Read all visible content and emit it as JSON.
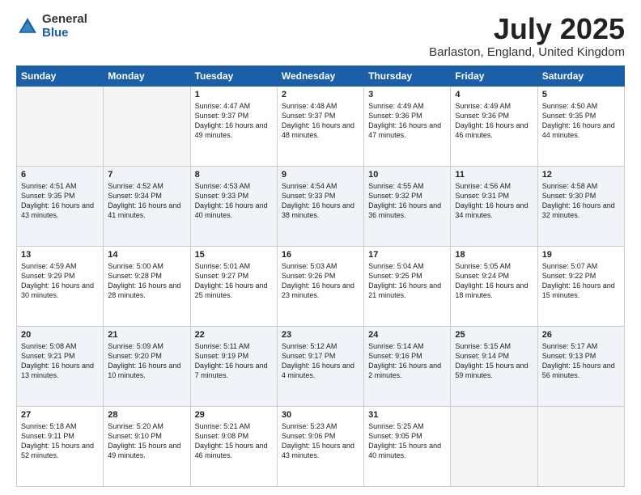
{
  "logo": {
    "general": "General",
    "blue": "Blue"
  },
  "title": {
    "month": "July 2025",
    "location": "Barlaston, England, United Kingdom"
  },
  "days_of_week": [
    "Sunday",
    "Monday",
    "Tuesday",
    "Wednesday",
    "Thursday",
    "Friday",
    "Saturday"
  ],
  "weeks": [
    [
      {
        "day": "",
        "sunrise": "",
        "sunset": "",
        "daylight": ""
      },
      {
        "day": "",
        "sunrise": "",
        "sunset": "",
        "daylight": ""
      },
      {
        "day": "1",
        "sunrise": "Sunrise: 4:47 AM",
        "sunset": "Sunset: 9:37 PM",
        "daylight": "Daylight: 16 hours and 49 minutes."
      },
      {
        "day": "2",
        "sunrise": "Sunrise: 4:48 AM",
        "sunset": "Sunset: 9:37 PM",
        "daylight": "Daylight: 16 hours and 48 minutes."
      },
      {
        "day": "3",
        "sunrise": "Sunrise: 4:49 AM",
        "sunset": "Sunset: 9:36 PM",
        "daylight": "Daylight: 16 hours and 47 minutes."
      },
      {
        "day": "4",
        "sunrise": "Sunrise: 4:49 AM",
        "sunset": "Sunset: 9:36 PM",
        "daylight": "Daylight: 16 hours and 46 minutes."
      },
      {
        "day": "5",
        "sunrise": "Sunrise: 4:50 AM",
        "sunset": "Sunset: 9:35 PM",
        "daylight": "Daylight: 16 hours and 44 minutes."
      }
    ],
    [
      {
        "day": "6",
        "sunrise": "Sunrise: 4:51 AM",
        "sunset": "Sunset: 9:35 PM",
        "daylight": "Daylight: 16 hours and 43 minutes."
      },
      {
        "day": "7",
        "sunrise": "Sunrise: 4:52 AM",
        "sunset": "Sunset: 9:34 PM",
        "daylight": "Daylight: 16 hours and 41 minutes."
      },
      {
        "day": "8",
        "sunrise": "Sunrise: 4:53 AM",
        "sunset": "Sunset: 9:33 PM",
        "daylight": "Daylight: 16 hours and 40 minutes."
      },
      {
        "day": "9",
        "sunrise": "Sunrise: 4:54 AM",
        "sunset": "Sunset: 9:33 PM",
        "daylight": "Daylight: 16 hours and 38 minutes."
      },
      {
        "day": "10",
        "sunrise": "Sunrise: 4:55 AM",
        "sunset": "Sunset: 9:32 PM",
        "daylight": "Daylight: 16 hours and 36 minutes."
      },
      {
        "day": "11",
        "sunrise": "Sunrise: 4:56 AM",
        "sunset": "Sunset: 9:31 PM",
        "daylight": "Daylight: 16 hours and 34 minutes."
      },
      {
        "day": "12",
        "sunrise": "Sunrise: 4:58 AM",
        "sunset": "Sunset: 9:30 PM",
        "daylight": "Daylight: 16 hours and 32 minutes."
      }
    ],
    [
      {
        "day": "13",
        "sunrise": "Sunrise: 4:59 AM",
        "sunset": "Sunset: 9:29 PM",
        "daylight": "Daylight: 16 hours and 30 minutes."
      },
      {
        "day": "14",
        "sunrise": "Sunrise: 5:00 AM",
        "sunset": "Sunset: 9:28 PM",
        "daylight": "Daylight: 16 hours and 28 minutes."
      },
      {
        "day": "15",
        "sunrise": "Sunrise: 5:01 AM",
        "sunset": "Sunset: 9:27 PM",
        "daylight": "Daylight: 16 hours and 25 minutes."
      },
      {
        "day": "16",
        "sunrise": "Sunrise: 5:03 AM",
        "sunset": "Sunset: 9:26 PM",
        "daylight": "Daylight: 16 hours and 23 minutes."
      },
      {
        "day": "17",
        "sunrise": "Sunrise: 5:04 AM",
        "sunset": "Sunset: 9:25 PM",
        "daylight": "Daylight: 16 hours and 21 minutes."
      },
      {
        "day": "18",
        "sunrise": "Sunrise: 5:05 AM",
        "sunset": "Sunset: 9:24 PM",
        "daylight": "Daylight: 16 hours and 18 minutes."
      },
      {
        "day": "19",
        "sunrise": "Sunrise: 5:07 AM",
        "sunset": "Sunset: 9:22 PM",
        "daylight": "Daylight: 16 hours and 15 minutes."
      }
    ],
    [
      {
        "day": "20",
        "sunrise": "Sunrise: 5:08 AM",
        "sunset": "Sunset: 9:21 PM",
        "daylight": "Daylight: 16 hours and 13 minutes."
      },
      {
        "day": "21",
        "sunrise": "Sunrise: 5:09 AM",
        "sunset": "Sunset: 9:20 PM",
        "daylight": "Daylight: 16 hours and 10 minutes."
      },
      {
        "day": "22",
        "sunrise": "Sunrise: 5:11 AM",
        "sunset": "Sunset: 9:19 PM",
        "daylight": "Daylight: 16 hours and 7 minutes."
      },
      {
        "day": "23",
        "sunrise": "Sunrise: 5:12 AM",
        "sunset": "Sunset: 9:17 PM",
        "daylight": "Daylight: 16 hours and 4 minutes."
      },
      {
        "day": "24",
        "sunrise": "Sunrise: 5:14 AM",
        "sunset": "Sunset: 9:16 PM",
        "daylight": "Daylight: 16 hours and 2 minutes."
      },
      {
        "day": "25",
        "sunrise": "Sunrise: 5:15 AM",
        "sunset": "Sunset: 9:14 PM",
        "daylight": "Daylight: 15 hours and 59 minutes."
      },
      {
        "day": "26",
        "sunrise": "Sunrise: 5:17 AM",
        "sunset": "Sunset: 9:13 PM",
        "daylight": "Daylight: 15 hours and 56 minutes."
      }
    ],
    [
      {
        "day": "27",
        "sunrise": "Sunrise: 5:18 AM",
        "sunset": "Sunset: 9:11 PM",
        "daylight": "Daylight: 15 hours and 52 minutes."
      },
      {
        "day": "28",
        "sunrise": "Sunrise: 5:20 AM",
        "sunset": "Sunset: 9:10 PM",
        "daylight": "Daylight: 15 hours and 49 minutes."
      },
      {
        "day": "29",
        "sunrise": "Sunrise: 5:21 AM",
        "sunset": "Sunset: 9:08 PM",
        "daylight": "Daylight: 15 hours and 46 minutes."
      },
      {
        "day": "30",
        "sunrise": "Sunrise: 5:23 AM",
        "sunset": "Sunset: 9:06 PM",
        "daylight": "Daylight: 15 hours and 43 minutes."
      },
      {
        "day": "31",
        "sunrise": "Sunrise: 5:25 AM",
        "sunset": "Sunset: 9:05 PM",
        "daylight": "Daylight: 15 hours and 40 minutes."
      },
      {
        "day": "",
        "sunrise": "",
        "sunset": "",
        "daylight": ""
      },
      {
        "day": "",
        "sunrise": "",
        "sunset": "",
        "daylight": ""
      }
    ]
  ]
}
